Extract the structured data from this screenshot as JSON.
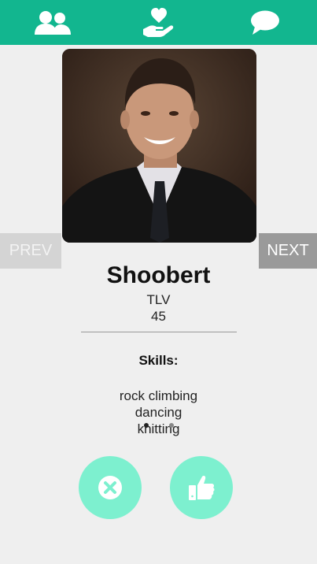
{
  "nav": {
    "people_icon": "people-icon",
    "care_icon": "heart-hand-icon",
    "chat_icon": "chat-bubble-icon",
    "bar_color": "#12b68f"
  },
  "profile": {
    "name": "Shoobert",
    "city": "TLV",
    "age": "45",
    "skills_title": "Skills:",
    "skills": [
      "rock climbing",
      "dancing",
      "knitting"
    ]
  },
  "controls": {
    "prev_label": "PREV",
    "next_label": "NEXT",
    "reject_icon": "x-circle-icon",
    "like_icon": "thumbs-up-icon",
    "action_color": "#7df0cf"
  }
}
